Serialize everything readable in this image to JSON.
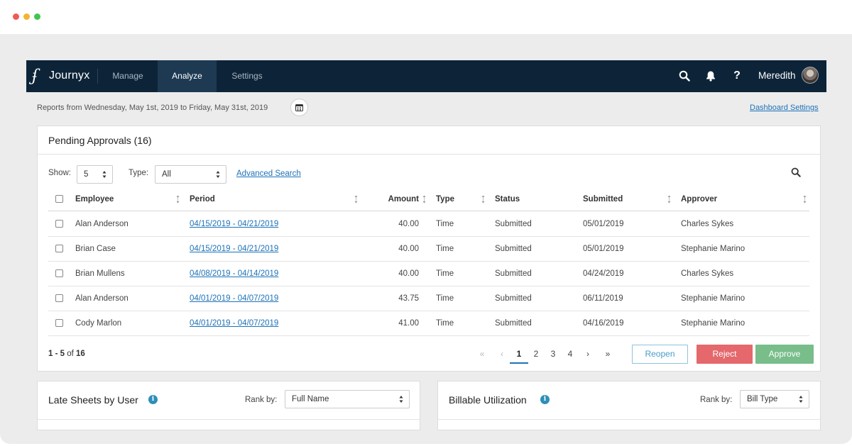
{
  "window": {
    "controls": [
      "close",
      "minimize",
      "maximize"
    ]
  },
  "nav": {
    "logo_mark": "ʄ",
    "brand": "Journyx",
    "tabs": [
      {
        "label": "Manage",
        "active": false
      },
      {
        "label": "Analyze",
        "active": true
      },
      {
        "label": "Settings",
        "active": false
      }
    ],
    "icons": [
      "search-icon",
      "bell-icon",
      "help-icon"
    ],
    "help_glyph": "?",
    "user_name": "Meredith"
  },
  "header": {
    "reports_range": "Reports from Wednesday, May 1st, 2019 to Friday, May 31st, 2019",
    "dashboard_settings": "Dashboard Settings"
  },
  "pending": {
    "title": "Pending Approvals (16)",
    "show_label": "Show:",
    "show_value": "5",
    "type_label": "Type:",
    "type_value": "All",
    "advanced_search": "Advanced Search",
    "columns": [
      "Employee",
      "Period",
      "Amount",
      "Type",
      "Status",
      "Submitted",
      "Approver"
    ],
    "rows": [
      {
        "employee": "Alan Anderson",
        "period": "04/15/2019 - 04/21/2019",
        "amount": "40.00",
        "type": "Time",
        "status": "Submitted",
        "submitted": "05/01/2019",
        "approver": "Charles Sykes"
      },
      {
        "employee": "Brian Case",
        "period": "04/15/2019 - 04/21/2019",
        "amount": "40.00",
        "type": "Time",
        "status": "Submitted",
        "submitted": "05/01/2019",
        "approver": "Stephanie Marino"
      },
      {
        "employee": "Brian Mullens",
        "period": "04/08/2019 - 04/14/2019",
        "amount": "40.00",
        "type": "Time",
        "status": "Submitted",
        "submitted": "04/24/2019",
        "approver": "Charles Sykes"
      },
      {
        "employee": "Alan Anderson",
        "period": "04/01/2019 - 04/07/2019",
        "amount": "43.75",
        "type": "Time",
        "status": "Submitted",
        "submitted": "06/11/2019",
        "approver": "Stephanie Marino"
      },
      {
        "employee": "Cody Marlon",
        "period": "04/01/2019 - 04/07/2019",
        "amount": "41.00",
        "type": "Time",
        "status": "Submitted",
        "submitted": "04/16/2019",
        "approver": "Stephanie Marino"
      }
    ],
    "range_prefix": "1 - 5",
    "range_of": "of",
    "range_total": "16",
    "pager": {
      "first": "«",
      "prev": "‹",
      "pages": [
        "1",
        "2",
        "3",
        "4"
      ],
      "current": "1",
      "next": "›",
      "last": "»"
    },
    "buttons": {
      "reopen": "Reopen",
      "reject": "Reject",
      "approve": "Approve"
    }
  },
  "late_sheets": {
    "title": "Late Sheets by User",
    "rank_label": "Rank by:",
    "rank_value": "Full Name"
  },
  "billable": {
    "title": "Billable Utilization",
    "rank_label": "Rank by:",
    "rank_value": "Bill Type"
  },
  "colors": {
    "nav_bg": "#0d2438",
    "nav_active": "#1e3a53",
    "link": "#1d72b8",
    "reject": "#e4686c",
    "approve": "#78bd8a",
    "reopen_border": "#8fc2dd",
    "info": "#2e8fb8"
  }
}
